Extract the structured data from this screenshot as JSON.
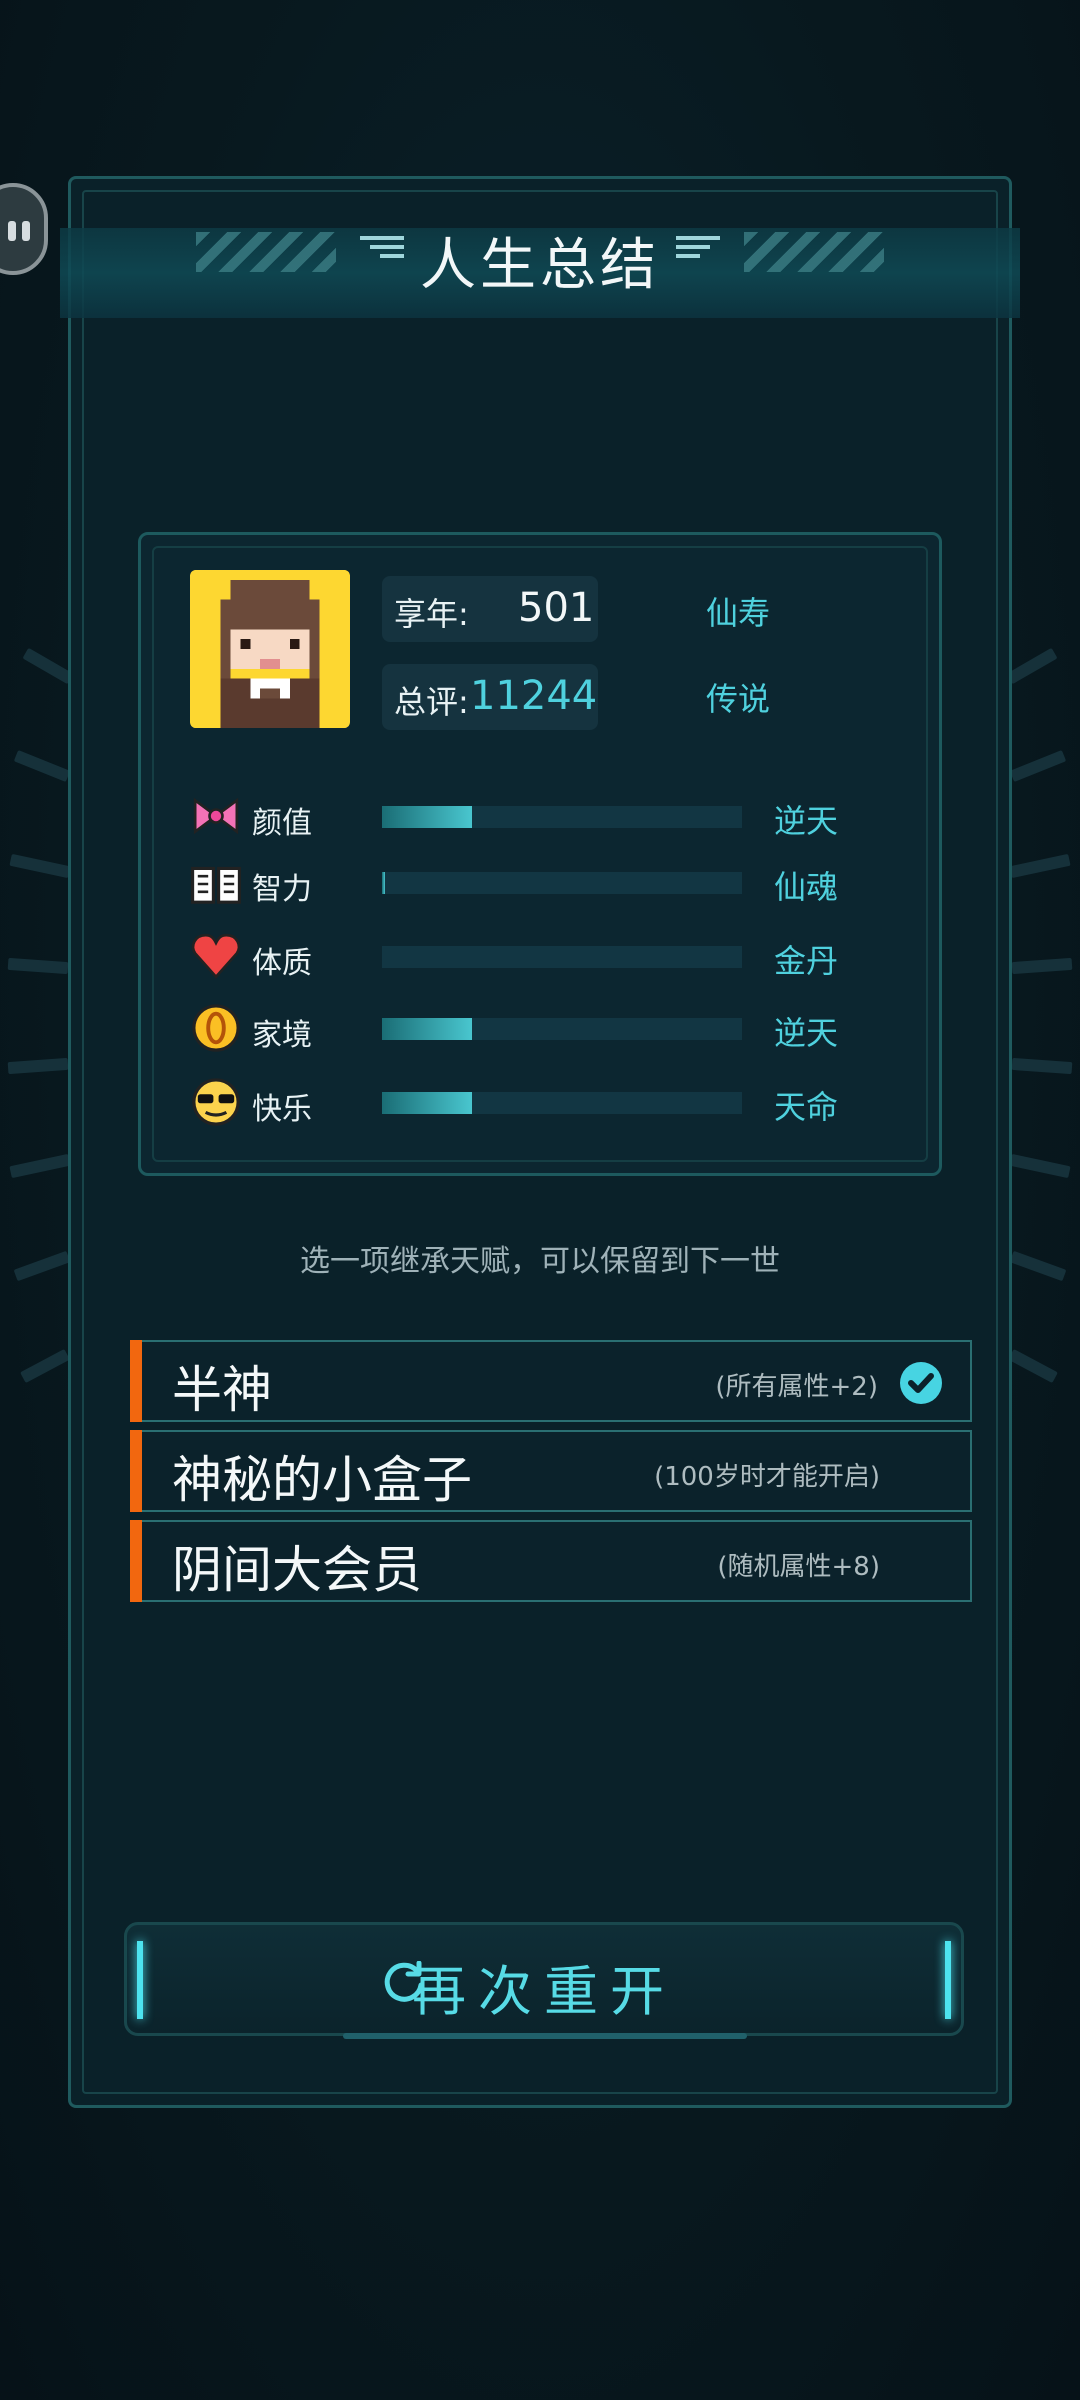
{
  "title": "人生总结",
  "summary": {
    "age_label": "享年:",
    "age_value": "501",
    "age_rank": "仙寿",
    "score_label": "总评:",
    "score_value": "11244",
    "score_rank": "传说"
  },
  "attributes": [
    {
      "name": "颜值",
      "icon": "bow-icon",
      "rank": "逆天",
      "level": 0.25
    },
    {
      "name": "智力",
      "icon": "book-icon",
      "rank": "仙魂",
      "level": 0.01
    },
    {
      "name": "体质",
      "icon": "heart-icon",
      "rank": "金丹",
      "level": 0.0
    },
    {
      "name": "家境",
      "icon": "coin-icon",
      "rank": "逆天",
      "level": 0.25
    },
    {
      "name": "快乐",
      "icon": "sunglasses-face-icon",
      "rank": "天命",
      "level": 0.25
    }
  ],
  "hint": "选一项继承天赋，可以保留到下一世",
  "talents": [
    {
      "name": "半神",
      "desc": "(所有属性+2)",
      "selected": true
    },
    {
      "name": "神秘的小盒子",
      "desc": "(100岁时才能开启)",
      "selected": false
    },
    {
      "name": "阴间大会员",
      "desc": "(随机属性+8)",
      "selected": false
    }
  ],
  "restart_label": "再次重开",
  "colors": {
    "accent": "#4fd1de",
    "stripe": "#f2670f",
    "bar_fill": "#49c6cf",
    "avatar_bg": "#fdd731"
  }
}
